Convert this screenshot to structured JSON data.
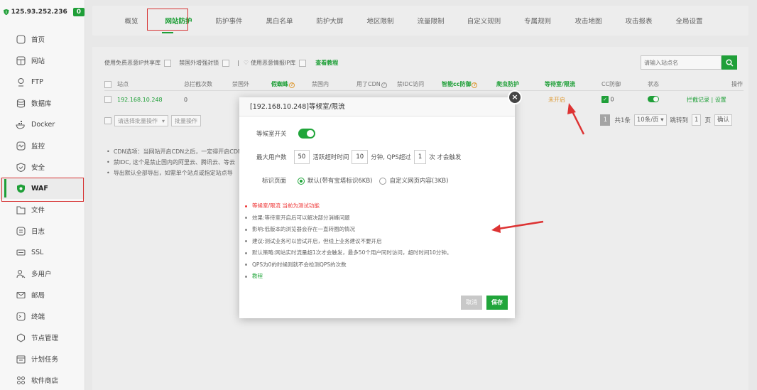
{
  "host": {
    "ip": "125.93.252.236",
    "badge": "0"
  },
  "sidebar": {
    "items": [
      {
        "label": "首页",
        "icon": "home-icon"
      },
      {
        "label": "网站",
        "icon": "globe-icon"
      },
      {
        "label": "FTP",
        "icon": "ftp-icon"
      },
      {
        "label": "数据库",
        "icon": "database-icon"
      },
      {
        "label": "Docker",
        "icon": "docker-icon"
      },
      {
        "label": "监控",
        "icon": "monitor-icon"
      },
      {
        "label": "安全",
        "icon": "shield-icon"
      },
      {
        "label": "WAF",
        "icon": "waf-icon"
      },
      {
        "label": "文件",
        "icon": "folder-icon"
      },
      {
        "label": "日志",
        "icon": "log-icon"
      },
      {
        "label": "SSL",
        "icon": "ssl-icon"
      },
      {
        "label": "多用户",
        "icon": "users-icon"
      },
      {
        "label": "邮局",
        "icon": "mail-icon"
      },
      {
        "label": "终端",
        "icon": "terminal-icon"
      },
      {
        "label": "节点管理",
        "icon": "node-icon"
      },
      {
        "label": "计划任务",
        "icon": "calendar-icon"
      },
      {
        "label": "软件商店",
        "icon": "apps-icon"
      }
    ]
  },
  "tabs": [
    "概览",
    "网站防护",
    "防护事件",
    "黑白名单",
    "防护大屏",
    "地区限制",
    "流量限制",
    "自定义规则",
    "专属规则",
    "攻击地图",
    "攻击报表",
    "全局设置"
  ],
  "toolbar": {
    "shared_ip": "使用免费恶意IP共享库",
    "block_foreign": "禁国外增强封锁",
    "sep": "|",
    "malicious_ip": "使用恶意情报IP库",
    "tutorial": "查看教程",
    "search_placeholder": "请输入站点名"
  },
  "table": {
    "headers": [
      "站点",
      "总拦截次数",
      "禁国外",
      "假蜘蛛",
      "禁国内",
      "用了CDN",
      "禁IDC访问",
      "智能cc防御",
      "爬虫防护",
      "等待室/限流",
      "CC防御",
      "状态",
      "操作"
    ],
    "row": {
      "site": "192.168.10.248",
      "count": "0",
      "wait_room": "未开启",
      "cc": "0",
      "actions": "拦截记录 | 设置"
    }
  },
  "batch": {
    "placeholder": "请选择批量操作",
    "button": "批量操作"
  },
  "pager": {
    "page": "1",
    "total": "共1条",
    "per_page": "10条/页",
    "jump_label": "跳转到",
    "jump_value": "1",
    "page_unit": "页",
    "confirm": "确认"
  },
  "tips": [
    "CDN选项：当网站开启CDN之后，一定得开启CDN",
    "禁IDC, 这个是禁止国内的阿里云、腾讯云、等云",
    "导出默认全部导出，如需单个站点或指定站点导"
  ],
  "modal": {
    "title": "[192.168.10.248]等候室/限流",
    "switch_label": "等候室开关",
    "max_users_label": "最大用户数",
    "max_users": "50",
    "active_timeout_label": "活跃超时时间",
    "active_timeout": "10",
    "minutes_label": "分钟, QPS超过",
    "qps": "1",
    "trigger_label": "次 才会触发",
    "page_label": "标识页面",
    "option_default": "默认(带有宝塔标识6KB)",
    "option_custom": "自定义网页内容(3KB)",
    "notes": [
      "等候室/限流 当前为测试功能",
      "效果:等待室开启后可以解决部分消峰问题",
      "影响:低版本的浏览器会存在一直转圈的情况",
      "建议:测试业务可以尝试开启，但线上业务建议不要开启",
      "默认策略:网站实时流量超1次才会触发，最多50个用户同时访问，超时时间10分钟。",
      "QPS为0的时候则就不会检测QPS的次数",
      "教程"
    ],
    "cancel": "取消",
    "save": "保存",
    "close": "×"
  },
  "colors": {
    "accent": "#20a53a",
    "highlight_border": "#dd3333",
    "warning": "#e6a23c"
  }
}
